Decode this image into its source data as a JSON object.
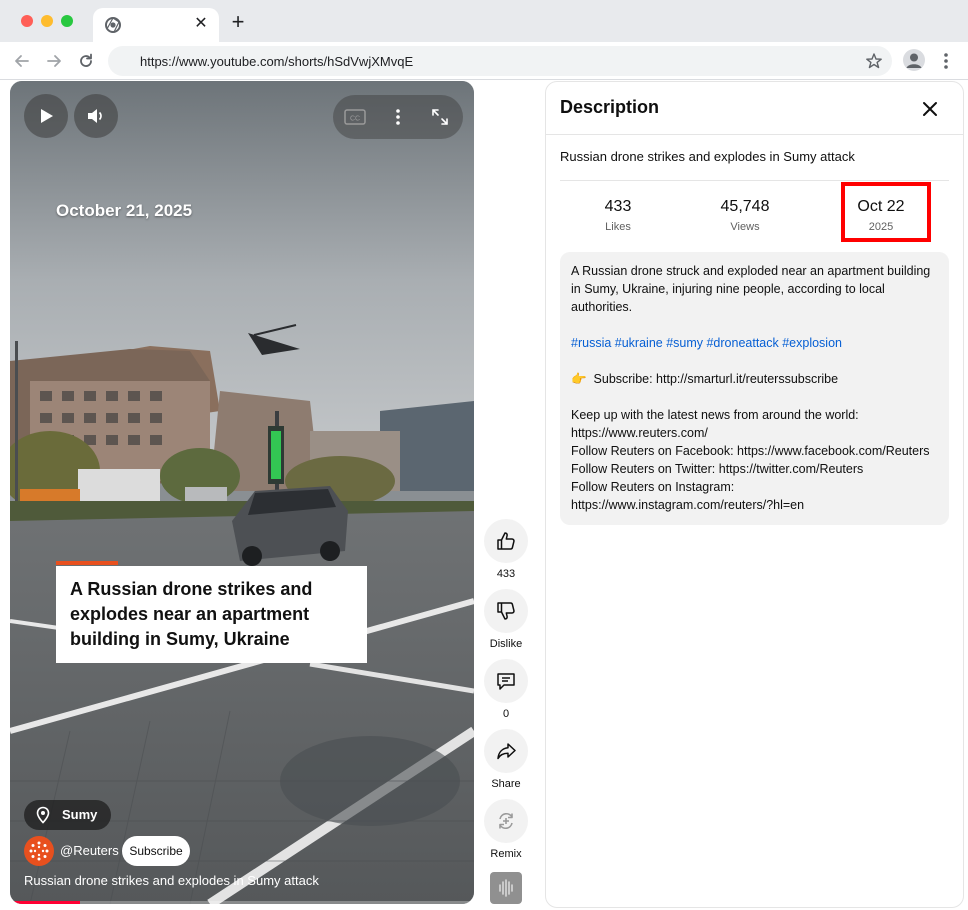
{
  "browser": {
    "url": "https://www.youtube.com/shorts/hSdVwjXMvqE",
    "new_tab_label": "+",
    "tab_close_label": "✕"
  },
  "video": {
    "date_overlay": "October 21, 2025",
    "caption_lines": [
      "A Russian drone strikes and",
      "explodes near an apartment",
      "building in Sumy, Ukraine"
    ],
    "location": "Sumy",
    "channel": "@Reuters",
    "subscribe_label": "Subscribe",
    "title": "Russian drone strikes and explodes in Sumy attack",
    "progress_fraction": 0.15
  },
  "actions": {
    "like_count": "433",
    "dislike_label": "Dislike",
    "comment_count": "0",
    "share_label": "Share",
    "remix_label": "Remix"
  },
  "description": {
    "heading": "Description",
    "video_title": "Russian drone strikes and explodes in Sumy attack",
    "stats": {
      "likes_value": "433",
      "likes_label": "Likes",
      "views_value": "45,748",
      "views_label": "Views",
      "date_value": "Oct 22",
      "date_year": "2025"
    },
    "body_lines": [
      "A Russian drone struck and exploded near an apartment building",
      "in Sumy, Ukraine, injuring nine people, according to local",
      "authorities."
    ],
    "hashtags": "#russia #ukraine #sumy #droneattack #explosion",
    "subscribe_emoji": "👉",
    "subscribe_line": "Subscribe: http://smarturl.it/reuterssubscribe",
    "links": [
      "Keep up with the latest news from around the world:",
      "https://www.reuters.com/",
      "Follow Reuters on Facebook: https://www.facebook.com/Reuters",
      "Follow Reuters on Twitter: https://twitter.com/Reuters",
      "Follow Reuters on Instagram:",
      "https://www.instagram.com/reuters/?hl=en"
    ]
  },
  "colors": {
    "accent_red": "#ff0000",
    "youtube_red": "#ff0033",
    "reuters_orange": "#e8501e",
    "hashtag_blue": "#065fd4"
  }
}
